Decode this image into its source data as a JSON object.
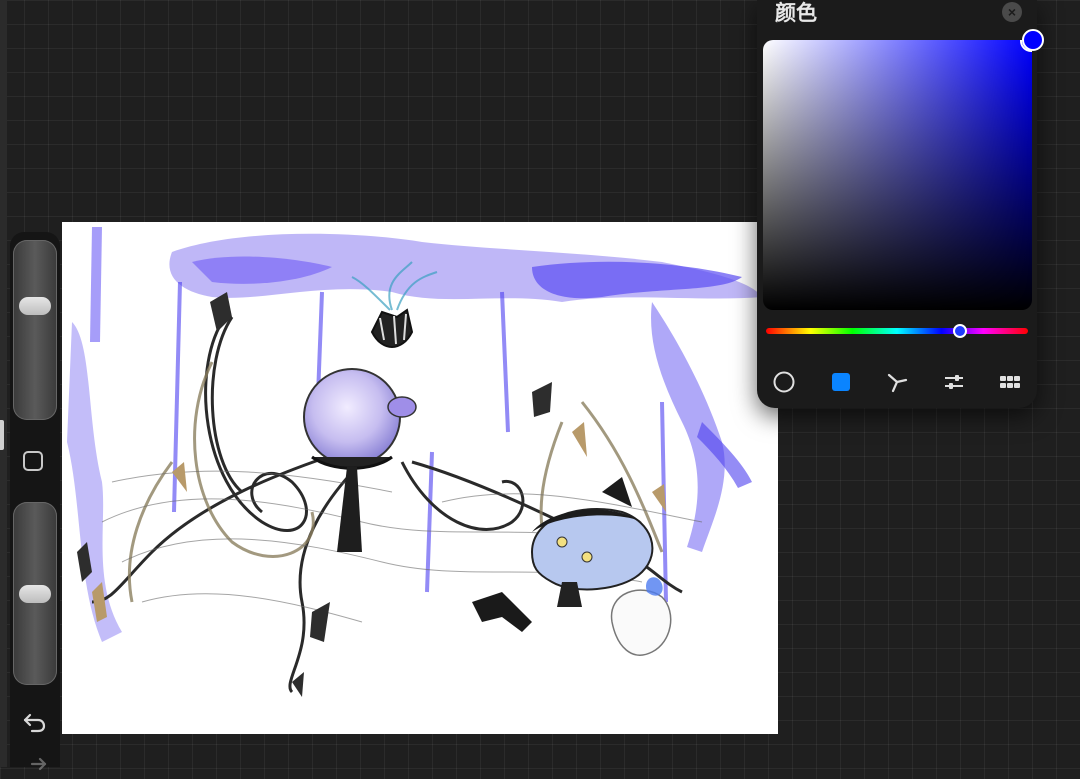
{
  "color_panel": {
    "title": "颜色",
    "close_label": "×",
    "current_color": "#0000ff",
    "hue_level": 0.74,
    "saturation": 1.0,
    "brightness": 1.0,
    "modes": [
      {
        "name": "disc",
        "icon": "circle-icon",
        "selected": false
      },
      {
        "name": "classic",
        "icon": "square-icon",
        "selected": true
      },
      {
        "name": "harmony",
        "icon": "harmony-icon",
        "selected": false
      },
      {
        "name": "value",
        "icon": "sliders-icon",
        "selected": false
      },
      {
        "name": "palettes",
        "icon": "grid-icon",
        "selected": false
      }
    ],
    "accent": "#0a84ff"
  },
  "sidebar": {
    "brush_size_level": 0.65,
    "opacity_level": 0.5,
    "modify_icon": "square-outline-icon",
    "undo_icon": "undo-arrow-icon",
    "redo_icon": "redo-arrow-icon"
  },
  "canvas": {
    "background": "#ffffff",
    "artwork": "sketch-illustration"
  }
}
